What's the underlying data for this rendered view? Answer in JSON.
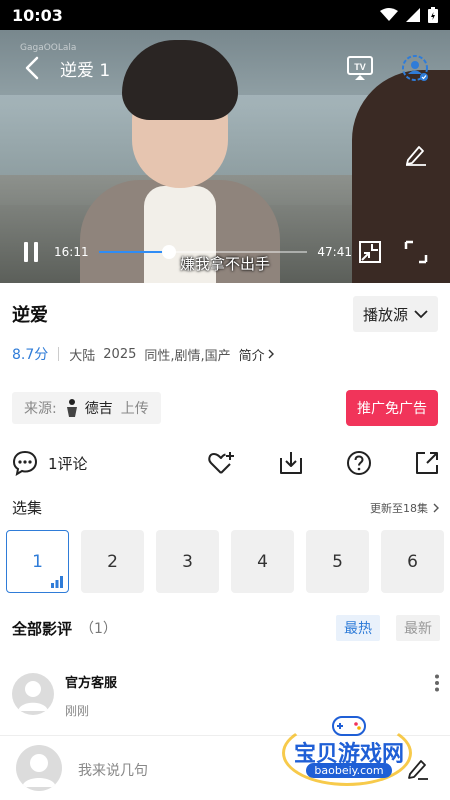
{
  "status_bar": {
    "time": "10:03"
  },
  "player": {
    "watermark": "GagaOOLala",
    "episode_title": "逆爱 1",
    "current_time": "16:11",
    "total_time": "47:41",
    "progress": 0.339,
    "subtitle": "嫌我拿不出手"
  },
  "show": {
    "title": "逆爱",
    "source_button": "播放源",
    "score": "8.7分",
    "region": "大陆",
    "year": "2025",
    "genres": "同性,剧情,国产",
    "intro_link": "简介"
  },
  "uploader": {
    "label": "来源:",
    "name": "德吉",
    "action": "上传",
    "promo_button": "推广免广告"
  },
  "actions": {
    "comment_label": "1评论"
  },
  "episodes": {
    "label": "选集",
    "update_info": "更新至18集",
    "items": [
      "1",
      "2",
      "3",
      "4",
      "5",
      "6"
    ],
    "active_index": 0
  },
  "reviews": {
    "label": "全部影评",
    "count": "（1）",
    "sort_hot": "最热",
    "sort_new": "最新",
    "items": [
      {
        "user": "官方客服",
        "time": "刚刚"
      }
    ]
  },
  "composer": {
    "placeholder": "我来说几句"
  },
  "site_mark": {
    "name": "宝贝游戏网",
    "url": "baobeiy.com"
  },
  "colors": {
    "accent": "#2f7cd8",
    "promo": "#f1345a",
    "progress": "#2f8cf5"
  }
}
